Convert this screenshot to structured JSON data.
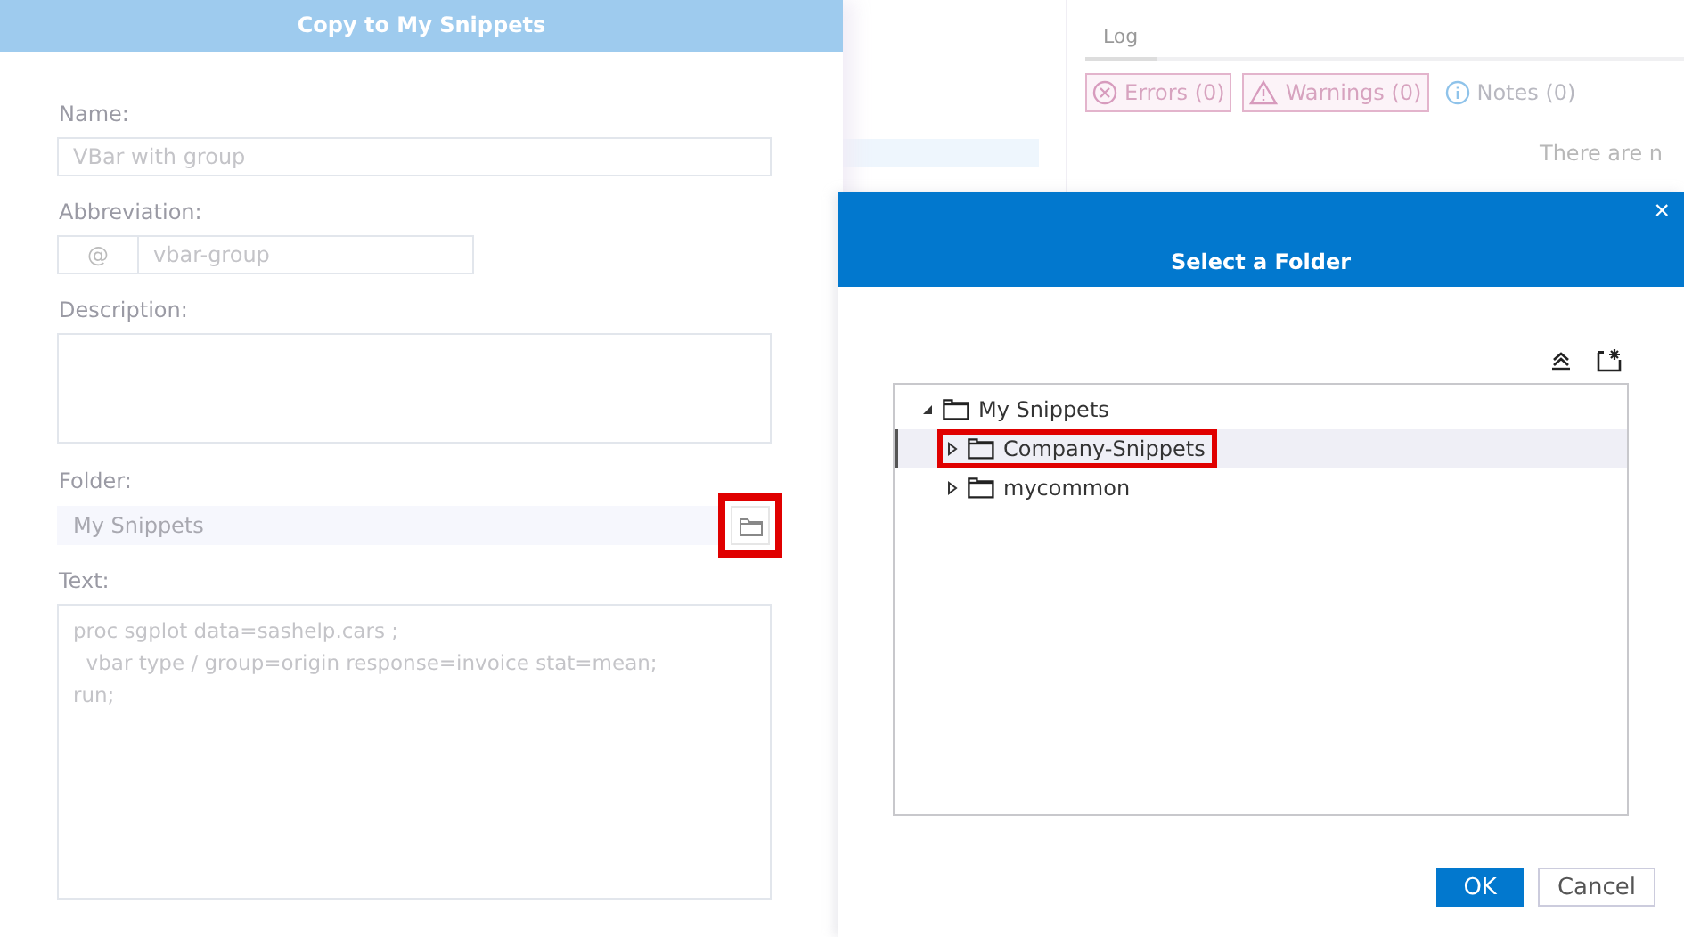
{
  "background_app": {
    "tabs": [
      {
        "label": "Log",
        "selected": true
      }
    ],
    "filters": [
      {
        "kind": "error",
        "label": "Errors (0)"
      },
      {
        "kind": "warning",
        "label": "Warnings (0)"
      },
      {
        "kind": "note",
        "label": "Notes (0)"
      }
    ],
    "message": "There are n"
  },
  "copy_dialog": {
    "title": "Copy to My Snippets",
    "name": {
      "label": "Name:",
      "value": "VBar with group"
    },
    "abbreviation": {
      "label": "Abbreviation:",
      "prefix": "@",
      "value": "vbar-group"
    },
    "description": {
      "label": "Description:"
    },
    "folder": {
      "label": "Folder:",
      "value": "My Snippets",
      "browse_highlighted": true
    },
    "text": {
      "label": "Text:",
      "lines": [
        "proc sgplot data=sashelp.cars ;",
        "  vbar type / group=origin response=invoice stat=mean;",
        "run;"
      ]
    }
  },
  "folder_dialog": {
    "title": "Select a Folder",
    "close": "×",
    "tree": [
      {
        "label": "My Snippets",
        "expanded": true,
        "selected": false,
        "highlighted": false,
        "children": [
          {
            "label": "Company-Snippets",
            "expanded": false,
            "selected": true,
            "highlighted": true
          },
          {
            "label": "mycommon",
            "expanded": false,
            "selected": false,
            "highlighted": false
          }
        ]
      }
    ],
    "buttons": [
      {
        "label": "OK",
        "kind": "primary"
      },
      {
        "label": "Cancel",
        "kind": "secondary"
      }
    ]
  }
}
